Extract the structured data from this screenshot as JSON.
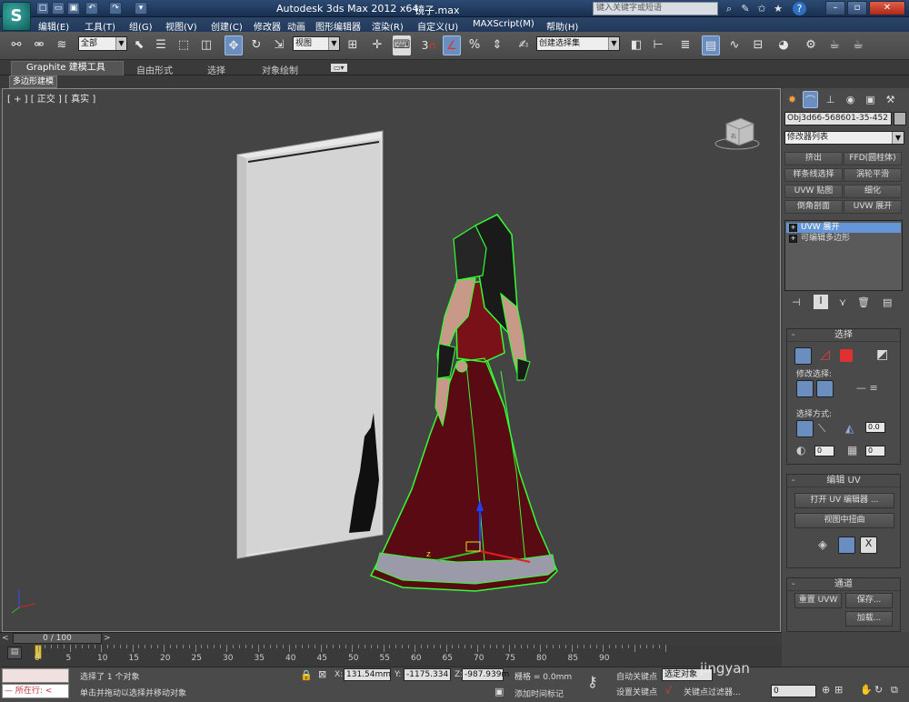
{
  "app": {
    "title": "Autodesk 3ds Max  2012 x64",
    "file": "镜子.max",
    "logo": "S",
    "search_placeholder": "键入关键字或短语"
  },
  "quick_access": [
    "new-icon",
    "open-icon",
    "save-icon",
    "undo-icon",
    "redo-icon",
    "dropdown-icon"
  ],
  "menu": [
    "编辑(E)",
    "工具(T)",
    "组(G)",
    "视图(V)",
    "创建(C)",
    "修改器",
    "动画",
    "图形编辑器",
    "渲染(R)",
    "自定义(U)",
    "MAXScript(M)",
    "帮助(H)"
  ],
  "toolbar": {
    "filter": "全部",
    "coord_system": "视图",
    "selection_set": "创建选择集",
    "snap_label": "3"
  },
  "ribbon": {
    "tabs": [
      "Graphite 建模工具",
      "自由形式",
      "选择",
      "对象绘制"
    ],
    "sub_tab": "多边形建模"
  },
  "viewport": {
    "label": "[ + ] [ 正交 ] [ 真实 ]"
  },
  "command_panel": {
    "object_name": "Obj3d66-568601-35-452",
    "modifier_list": "修改器列表",
    "modifier_buttons": [
      "挤出",
      "FFD(圆柱体)",
      "样条线选择",
      "涡轮平滑",
      "UVW 贴图",
      "细化",
      "倒角剖面",
      "UVW 展开"
    ],
    "stack": [
      {
        "label": "UVW 展开",
        "selected": true
      },
      {
        "label": "可编辑多边形",
        "selected": false
      }
    ],
    "select_rollout": {
      "title": "选择",
      "modify_selection": "修改选择:",
      "select_method": "选择方式:",
      "angle_value": "0.0",
      "spin1": "0",
      "spin2": "0"
    },
    "edit_uv": {
      "title": "编辑 UV",
      "open_editor": "打开 UV 编辑器 ...",
      "tweak": "视图中扭曲"
    },
    "channel": {
      "title": "通道",
      "reset": "重置 UVW",
      "save": "保存...",
      "load": "加载..."
    }
  },
  "timeline": {
    "frame": "0 / 100",
    "ticks": [
      0,
      5,
      10,
      15,
      20,
      25,
      30,
      35,
      40,
      45,
      50,
      55,
      60,
      65,
      70,
      75,
      80,
      85,
      90
    ]
  },
  "status": {
    "running": "所在行:",
    "selected": "选择了 1 个对象",
    "hint": "单击并拖动以选择并移动对象",
    "x_label": "X:",
    "x": "131.54mm",
    "y_label": "Y:",
    "y": "-1175.334",
    "z_label": "Z:",
    "z": "-987.939m",
    "grid": "栅格 = 0.0mm",
    "add_time_tag": "添加时间标记",
    "auto_key": "自动关键点",
    "selected_obj": "选定对象",
    "set_key": "设置关键点",
    "key_filter": "关键点过滤器...",
    "frame_value": "0"
  },
  "watermark": "jingyan"
}
